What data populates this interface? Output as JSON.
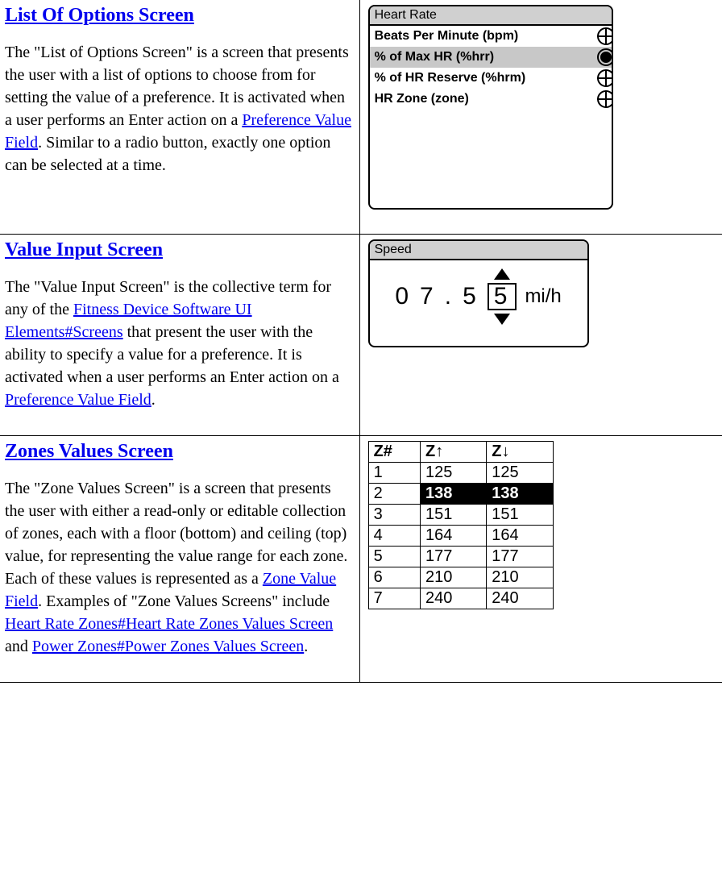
{
  "sections": [
    {
      "heading": "List Of Options Screen",
      "para_pre": "The \"List of Options Screen\" is a screen that presents the user with a list of options to choose from for setting the value of a preference. It is activated when a user performs an Enter action on a ",
      "link1": "Preference Value Field",
      "para_post": ". Similar to a radio button, exactly one option can be selected at a time."
    },
    {
      "heading": "Value Input Screen",
      "para_pre": "The \"Value Input Screen\" is the collective term for any of the ",
      "link1": "Fitness Device Software UI Elements#Screens",
      "para_mid": " that present the user with the ability to specify a value for a preference. It is activated when a user performs an Enter action on a ",
      "link2": "Preference Value Field",
      "para_post": "."
    },
    {
      "heading": "Zones Values Screen",
      "para_pre": "The \"Zone Values Screen\" is a screen that presents the user with either a read-only or editable collection of zones, each with a floor (bottom) and ceiling (top) value, for representing the value range for each zone. Each of these values is represented as a ",
      "link1": "Zone Value Field",
      "para_mid": ". Examples of \"Zone Values Screens\" include ",
      "link2": "Heart Rate Zones#Heart Rate Zones Values Screen",
      "para_mid2": " and ",
      "link3": "Power Zones#Power Zones Values Screen",
      "para_post": "."
    }
  ],
  "hr_device": {
    "title": "Heart Rate",
    "options": [
      {
        "label": "Beats Per Minute (bpm)",
        "selected": false
      },
      {
        "label": "% of Max HR (%hrr)",
        "selected": true
      },
      {
        "label": "% of HR Reserve (%hrm)",
        "selected": false
      },
      {
        "label": "HR Zone (zone)",
        "selected": false
      }
    ]
  },
  "sp_device": {
    "title": "Speed",
    "d0": "0",
    "d1": "7",
    "dot": ".",
    "d2": "5",
    "d3": "5",
    "unit": "mi/h"
  },
  "zones": {
    "h0": "Z#",
    "h1": "Z",
    "h2": "Z",
    "rows": [
      {
        "n": "1",
        "up": "125",
        "dn": "125",
        "hl": false
      },
      {
        "n": "2",
        "up": "138",
        "dn": "138",
        "hl": true
      },
      {
        "n": "3",
        "up": "151",
        "dn": "151",
        "hl": false
      },
      {
        "n": "4",
        "up": "164",
        "dn": "164",
        "hl": false
      },
      {
        "n": "5",
        "up": "177",
        "dn": "177",
        "hl": false
      },
      {
        "n": "6",
        "up": "210",
        "dn": "210",
        "hl": false
      },
      {
        "n": "7",
        "up": "240",
        "dn": "240",
        "hl": false
      }
    ]
  }
}
